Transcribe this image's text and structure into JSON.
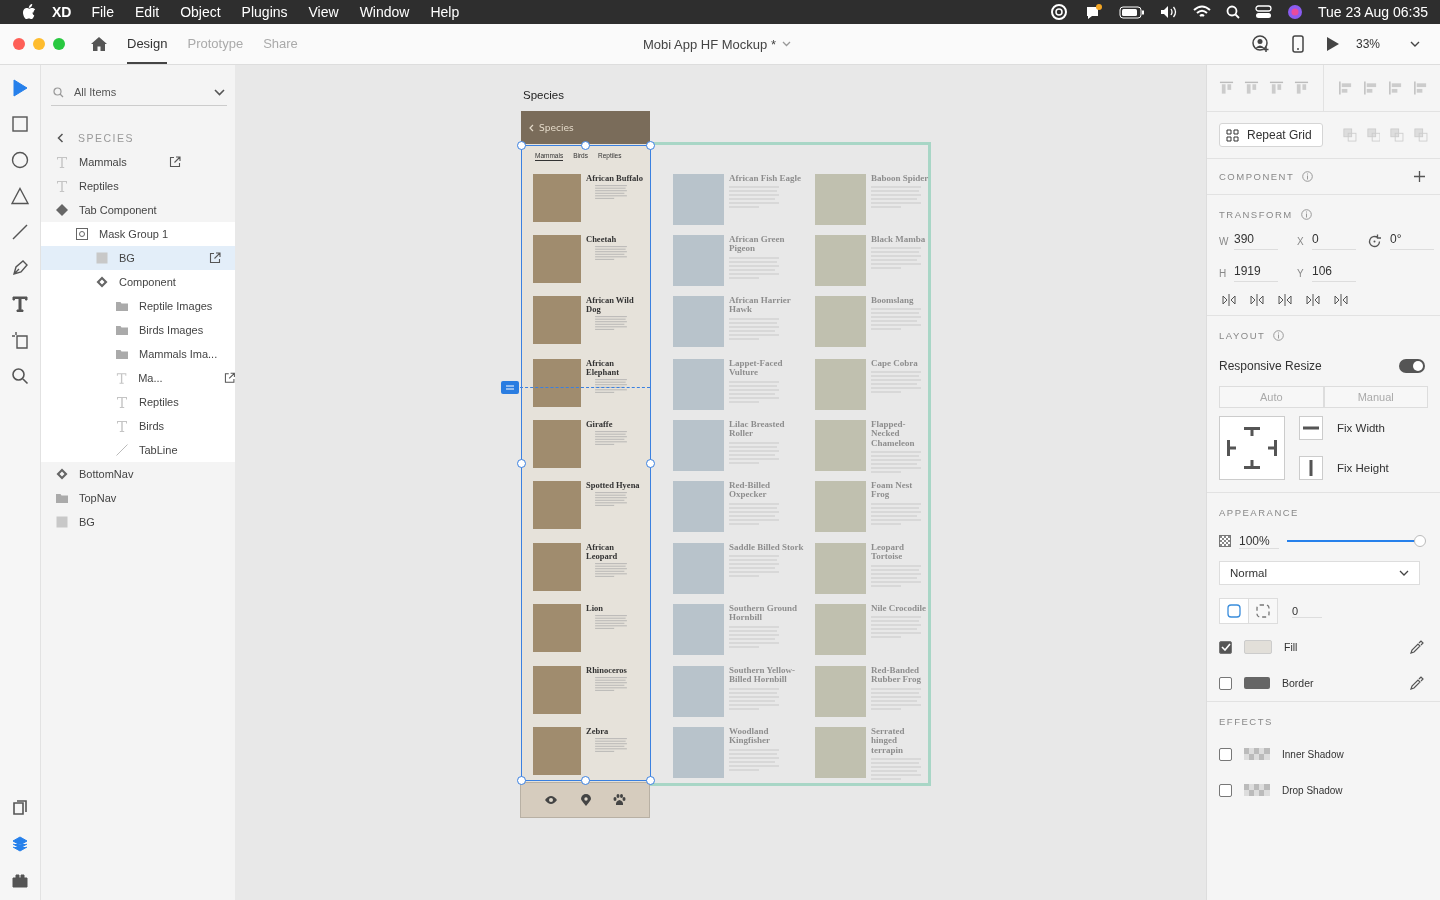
{
  "menubar": {
    "app": "XD",
    "menus": [
      "File",
      "Edit",
      "Object",
      "Plugins",
      "View",
      "Window",
      "Help"
    ],
    "clock": "Tue 23 Aug  06:35"
  },
  "toolbar": {
    "tabs": [
      {
        "label": "Design",
        "selected": true
      },
      {
        "label": "Prototype",
        "selected": false
      },
      {
        "label": "Share",
        "selected": false
      }
    ],
    "title": "Mobi App HF Mockup *",
    "zoom": "33%"
  },
  "tools": [
    {
      "kind": "select",
      "selected": true
    },
    {
      "kind": "rectangle",
      "selected": false
    },
    {
      "kind": "ellipse",
      "selected": false
    },
    {
      "kind": "triangle",
      "selected": false
    },
    {
      "kind": "line",
      "selected": false
    },
    {
      "kind": "pen",
      "selected": false
    },
    {
      "kind": "text",
      "selected": false
    },
    {
      "kind": "artboard",
      "selected": false
    },
    {
      "kind": "zoom",
      "selected": false
    }
  ],
  "bottom_tools": [
    {
      "kind": "assets",
      "selected": false
    },
    {
      "kind": "layers",
      "selected": true
    },
    {
      "kind": "plugins",
      "selected": false
    }
  ],
  "layers": {
    "filter": "All Items",
    "breadcrumb": "SPECIES",
    "items": [
      {
        "kind": "text",
        "name": "Mammals",
        "link": true,
        "selected": false
      },
      {
        "kind": "text",
        "name": "Reptiles",
        "link": false,
        "selected": false
      },
      {
        "kind": "main-component",
        "name": "Tab Component",
        "link": false,
        "selected": false,
        "children": [
          {
            "kind": "mask",
            "name": "Mask Group 1",
            "link": false,
            "selected": false,
            "children": [
              {
                "kind": "rect",
                "name": "BG",
                "link": true,
                "selected": true
              },
              {
                "kind": "component",
                "name": "Component",
                "link": false,
                "selected": false,
                "children": [
                  {
                    "kind": "folder",
                    "name": "Reptile Images",
                    "link": false,
                    "selected": false
                  },
                  {
                    "kind": "folder",
                    "name": "Birds Images",
                    "link": false,
                    "selected": false
                  },
                  {
                    "kind": "folder",
                    "name": "Mammals Ima...",
                    "link": false,
                    "selected": false
                  },
                  {
                    "kind": "text",
                    "name": "Ma...",
                    "link": true,
                    "selected": false
                  },
                  {
                    "kind": "text",
                    "name": "Reptiles",
                    "link": false,
                    "selected": false
                  },
                  {
                    "kind": "text",
                    "name": "Birds",
                    "link": false,
                    "selected": false
                  },
                  {
                    "kind": "line",
                    "name": "TabLine",
                    "link": false,
                    "selected": false
                  }
                ]
              }
            ]
          }
        ]
      },
      {
        "kind": "component",
        "name": "BottomNav",
        "link": false,
        "selected": false
      },
      {
        "kind": "folder",
        "name": "TopNav",
        "link": false,
        "selected": false
      },
      {
        "kind": "rect",
        "name": "BG",
        "link": false,
        "selected": false
      }
    ]
  },
  "artboard": {
    "label": "Species",
    "header": "Species",
    "tabs": [
      {
        "label": "Mammals",
        "selected": true
      },
      {
        "label": "Birds",
        "selected": false
      },
      {
        "label": "Reptiles",
        "selected": false
      }
    ],
    "columns": [
      {
        "names": [
          "African Buffalo",
          "Cheetah",
          "African Wild Dog",
          "African Elephant",
          "Giraffe",
          "Spotted Hyena",
          "African Leopard",
          "Lion",
          "Rhinoceros",
          "Zebra"
        ]
      },
      {
        "names": [
          "African Fish Eagle",
          "African Green Pigeon",
          "African Harrier Hawk",
          "Lappet-Faced Vulture",
          "Lilac Breasted Roller",
          "Red-Billed Oxpecker",
          "Saddle Billed Stork",
          "Southern Ground Hornbill",
          "Southern Yellow-Billed Hornbill",
          "Woodland Kingfisher"
        ]
      },
      {
        "names": [
          "Baboon Spider",
          "Black Mamba",
          "Boomslang",
          "Cape Cobra",
          "Flapped-Necked Chameleon",
          "Foam Nest Frog",
          "Leopard Tortoise",
          "Nile Crocodile",
          "Red-Banded Rubber Frog",
          "Serrated hinged terrapin"
        ]
      }
    ]
  },
  "inspector": {
    "repeat_grid": "Repeat Grid",
    "component": "COMPONENT",
    "transform": {
      "title": "TRANSFORM",
      "fields": [
        {
          "label": "W",
          "value": "390"
        },
        {
          "label": "X",
          "value": "0"
        },
        {
          "label": "H",
          "value": "1919"
        },
        {
          "label": "Y",
          "value": "106"
        }
      ],
      "rotation": "0°"
    },
    "layout": {
      "title": "LAYOUT",
      "responsive": "Responsive Resize",
      "on": true,
      "modes": [
        {
          "label": "Auto",
          "selected": false
        },
        {
          "label": "Manual",
          "selected": false
        }
      ],
      "fix_width": "Fix Width",
      "fix_height": "Fix Height"
    },
    "appearance": {
      "title": "APPEARANCE",
      "opacity": "100%",
      "level": 1,
      "blend": "Normal",
      "radius": "0",
      "paints": [
        {
          "label": "Fill",
          "checked": true,
          "kind": "fill"
        },
        {
          "label": "Border",
          "checked": false,
          "kind": "border"
        }
      ]
    },
    "effects": {
      "title": "EFFECTS",
      "items": [
        {
          "label": "Inner Shadow",
          "checked": false
        },
        {
          "label": "Drop Shadow",
          "checked": false
        }
      ]
    }
  }
}
